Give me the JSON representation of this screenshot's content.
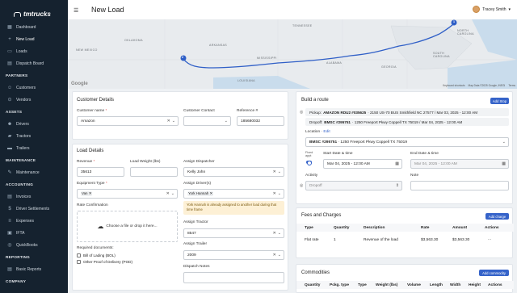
{
  "app": {
    "logo_text": "tmtrucks",
    "page_title": "New Load"
  },
  "user": {
    "name": "Tracey Smith",
    "caret": "▾"
  },
  "sidebar": {
    "items_top": [
      {
        "label": "Dashboard",
        "icon": "dashboard-icon",
        "glyph": "▦"
      },
      {
        "label": "New Load",
        "icon": "plus-icon",
        "glyph": "+"
      },
      {
        "label": "Loads",
        "icon": "truck-icon",
        "glyph": "▭"
      },
      {
        "label": "Dispatch Board",
        "icon": "board-icon",
        "glyph": "▤"
      }
    ],
    "partners": {
      "title": "PARTNERS",
      "items": [
        {
          "label": "Customers",
          "icon": "users-icon",
          "glyph": "☺"
        },
        {
          "label": "Vendors",
          "icon": "vendor-icon",
          "glyph": "⊙"
        }
      ]
    },
    "assets": {
      "title": "ASSETS",
      "items": [
        {
          "label": "Drivers",
          "icon": "driver-icon",
          "glyph": "☻"
        },
        {
          "label": "Tractors",
          "icon": "tractor-icon",
          "glyph": "▰"
        },
        {
          "label": "Trailers",
          "icon": "trailer-icon",
          "glyph": "▬"
        }
      ]
    },
    "maintenance": {
      "title": "MAINTENANCE",
      "items": [
        {
          "label": "Maintenance",
          "icon": "wrench-icon",
          "glyph": "✎"
        }
      ]
    },
    "accounting": {
      "title": "ACCOUNTING",
      "items": [
        {
          "label": "Invoices",
          "icon": "invoice-icon",
          "glyph": "▤"
        },
        {
          "label": "Driver Settlements",
          "icon": "settlement-icon",
          "glyph": "$"
        },
        {
          "label": "Expenses",
          "icon": "expenses-icon",
          "glyph": "≡"
        },
        {
          "label": "IFTA",
          "icon": "ifta-icon",
          "glyph": "▣"
        },
        {
          "label": "QuickBooks",
          "icon": "quickbooks-icon",
          "glyph": "◎"
        }
      ]
    },
    "reporting": {
      "title": "REPORTING",
      "items": [
        {
          "label": "Basic Reports",
          "icon": "report-icon",
          "glyph": "▤"
        }
      ]
    },
    "company": {
      "title": "COMPANY"
    }
  },
  "map": {
    "labels": [
      "TENNESSEE",
      "NORTH CAROLINA",
      "SOUTH CAROLINA",
      "GEORGIA",
      "ALABAMA",
      "MISSISSIPPI",
      "ARKANSAS",
      "OKLAHOMA",
      "NEW MEXICO",
      "LOUISIANA"
    ],
    "markers": [
      "1",
      "2"
    ],
    "google": "Google",
    "footer": [
      "Keyboard shortcuts",
      "Map Data ©2025 Google, INEGI",
      "Terms"
    ]
  },
  "customer_details": {
    "title": "Customer Details",
    "customer_name_label": "Customer name",
    "customer_name_value": "Amazon",
    "customer_contact_label": "Customer Contact",
    "reference_label": "Reference #",
    "reference_value": "185680032"
  },
  "load_details": {
    "title": "Load Details",
    "revenue_label": "Revenue",
    "revenue_value": "35613",
    "weight_label": "Load Weight (lbs)",
    "dispatcher_label": "Assign Dispatcher",
    "dispatcher_value": "Kelly John",
    "equipment_label": "Equipment Type",
    "equipment_chip": "Van",
    "drivers_label": "Assign Driver(s)",
    "drivers_chip": "York Hannah",
    "driver_warning": "York Hannah is already assigned to another load during that time frame",
    "rate_label": "Rate Confirmation",
    "dropzone_text": "Choose a file or drop it here...",
    "tractor_label": "Assign Tractor",
    "tractor_value": "8547",
    "required_docs_label": "Required documents:",
    "doc_options": [
      "Bill of Lading (BOL)",
      "Other Proof of Delivery (POD)"
    ],
    "trailer_label": "Assign Trailer",
    "trailer_value": "2009",
    "dispatch_notes_label": "Dispatch Notes"
  },
  "route": {
    "title": "Build a route",
    "add_stop": "Add Stop",
    "pickup_label": "Pickup:",
    "pickup_name": "AMAZON RDU2 #035625",
    "pickup_rest": "· 2150 US-70 BUS Smithfield NC 27577 / Mar 03, 2025 - 12:00 AM",
    "dropoff_label": "Dropoff:",
    "dropoff_name": "BMSC #295751",
    "dropoff_rest": "· 1250 Freeport Pkwy Coppell TX 75019 / Mar 04, 2025 - 12:00 AM",
    "location_label": "Location",
    "edit": "Edit",
    "location_name": "BMSC #295751",
    "location_rest": "· 1250 Freeport Pkwy Coppell TX 75019",
    "fixed_appt": "Fixed appt",
    "start_label": "Start Date & time",
    "start_value": "Mar 04, 2025 - 12:00 AM",
    "end_label": "End Date & time",
    "end_value": "Mar 04, 2025 - 12:00 AM",
    "activity_label": "Activity",
    "activity_value": "Dropoff",
    "note_label": "Note"
  },
  "fees": {
    "title": "Fees and Charges",
    "add_btn": "Add charge",
    "headers": [
      "Type",
      "Quantity",
      "Description",
      "Rate",
      "Amount",
      "Actions"
    ],
    "rows": [
      [
        "Flat rate",
        "1",
        "Revenue of the load",
        "$3,563.30",
        "$3,563.30",
        "..."
      ]
    ]
  },
  "commodities": {
    "title": "Commodities",
    "add_btn": "Add commodity",
    "headers": [
      "Quantity",
      "Pckg. type",
      "Type",
      "Weight (lbs)",
      "Volume",
      "Length",
      "Width",
      "Height",
      "Actions"
    ]
  }
}
